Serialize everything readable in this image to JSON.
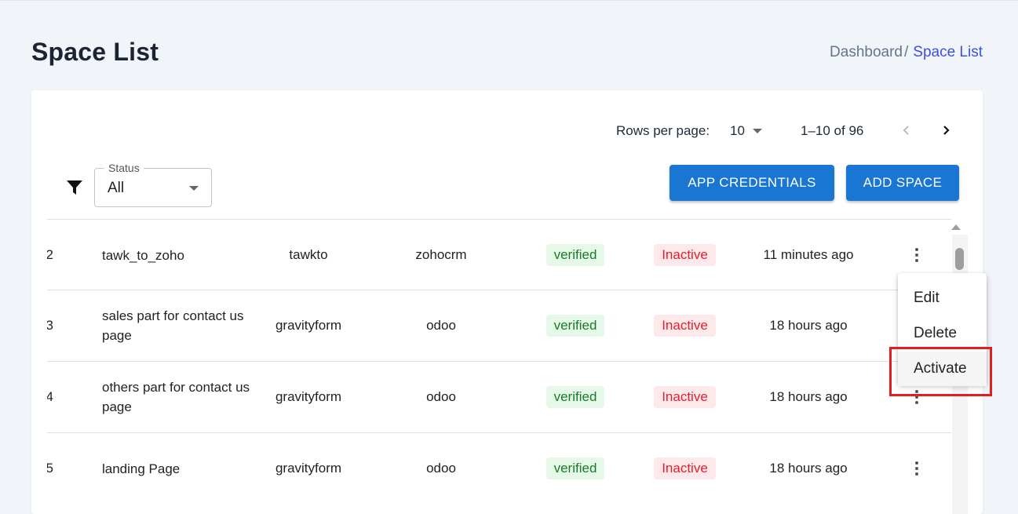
{
  "page": {
    "title": "Space List"
  },
  "breadcrumb": {
    "home": "Dashboard",
    "separator": "/",
    "current": "Space List"
  },
  "pagination": {
    "rows_label": "Rows per page:",
    "rows_value": "10",
    "range": "1–10 of 96"
  },
  "filter": {
    "status_label": "Status",
    "status_value": "All"
  },
  "buttons": {
    "app_credentials": "APP CREDENTIALS",
    "add_space": "ADD SPACE"
  },
  "rows": [
    {
      "id": "2",
      "name": "tawk_to_zoho",
      "source": "tawkto",
      "destination": "zohocrm",
      "verification": "verified",
      "status": "Inactive",
      "updated": "11 minutes ago"
    },
    {
      "id": "3",
      "name": "sales part for contact us page",
      "source": "gravityform",
      "destination": "odoo",
      "verification": "verified",
      "status": "Inactive",
      "updated": "18 hours ago"
    },
    {
      "id": "4",
      "name": "others part for contact us page",
      "source": "gravityform",
      "destination": "odoo",
      "verification": "verified",
      "status": "Inactive",
      "updated": "18 hours ago"
    },
    {
      "id": "5",
      "name": "landing Page",
      "source": "gravityform",
      "destination": "odoo",
      "verification": "verified",
      "status": "Inactive",
      "updated": "18 hours ago"
    }
  ],
  "context_menu": {
    "edit": "Edit",
    "delete": "Delete",
    "activate": "Activate"
  },
  "colors": {
    "primary_button": "#1976d2",
    "breadcrumb_active": "#3c50e0",
    "verified_bg": "#e6f8e8",
    "inactive_bg": "#fde8ea",
    "highlight": "#e02020"
  }
}
